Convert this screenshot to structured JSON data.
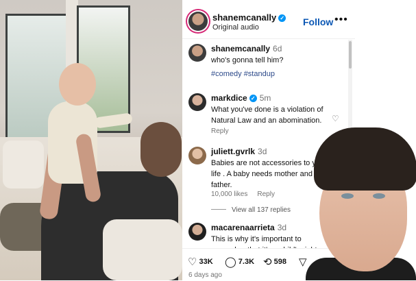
{
  "post": {
    "username": "shanemcanally",
    "audio": "Original audio",
    "follow_label": "Follow",
    "more_label": "•••"
  },
  "caption": {
    "username": "shanemcanally",
    "time": "6d",
    "text": "who's gonna tell him?",
    "tags": "#comedy #standup"
  },
  "comments": [
    {
      "username": "markdice",
      "verified": true,
      "time": "5m",
      "text": "What you've done is a violation of Natural Law and an abomination.",
      "meta": [
        "Reply"
      ]
    },
    {
      "username": "juliett.gvrlk",
      "verified": false,
      "time": "3d",
      "text": "Babies are not accessories to your life . A baby needs mother and father.",
      "meta": [
        "10,000 likes",
        "Reply"
      ]
    },
    {
      "username": "macarenaarrieta",
      "verified": false,
      "time": "3d",
      "text": "This is why it's important to remember that it's a child's right",
      "meta": []
    }
  ],
  "view_replies": "View all 137 replies",
  "stats": {
    "likes": "33K",
    "comments": "7.3K",
    "reposts": "598"
  },
  "posted_ago": "6 days ago",
  "icons": {
    "verified": "verified-badge-icon",
    "like": "heart-icon",
    "comment": "comment-bubble-icon",
    "repost": "repost-icon",
    "share": "send-icon"
  },
  "colors": {
    "verified": "#0095f6",
    "follow": "#0b57b4",
    "hashtag": "#2d4a8a"
  }
}
